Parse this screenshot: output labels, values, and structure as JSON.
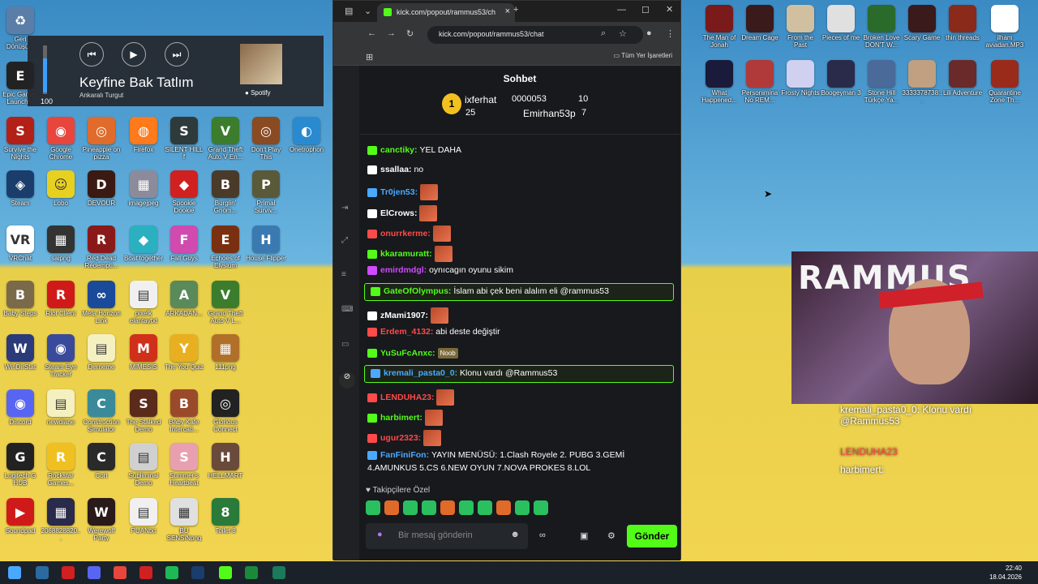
{
  "desktop_icons": [
    {
      "label": "Geri Dönüşüm",
      "color": "#5b7ea8",
      "glyph": "♻"
    },
    {
      "label": "Epic Games Launcher",
      "color": "#222222",
      "glyph": "E"
    },
    {
      "label": "Google Chrome",
      "color": "#e8453c",
      "glyph": "◉"
    },
    {
      "label": "Pineapple on pizza",
      "color": "#e06b2a",
      "glyph": "◎"
    },
    {
      "label": "Firefox",
      "color": "#ff7a1a",
      "glyph": "◍"
    },
    {
      "label": "SILENT HILL f",
      "color": "#2f3a3a",
      "glyph": "S"
    },
    {
      "label": "Grand Theft Auto V En...",
      "color": "#3b7d2c",
      "glyph": "V"
    },
    {
      "label": "Don't Play This",
      "color": "#8a4a22",
      "glyph": "◎"
    },
    {
      "label": "Onetrophon",
      "color": "#2a8ad0",
      "glyph": "◐"
    },
    {
      "label": "Survive the Nights",
      "color": "#b32018",
      "glyph": "S"
    },
    {
      "label": "Steam",
      "color": "#1b3d6b",
      "glyph": "◈"
    },
    {
      "label": "Lobo",
      "color": "#e8d020",
      "glyph": "☺"
    },
    {
      "label": "DEVOUR",
      "color": "#3a1a12",
      "glyph": "D"
    },
    {
      "label": "imagejpeg",
      "color": "#8b8b9b",
      "glyph": "▦"
    },
    {
      "label": "Spookie Dookie",
      "color": "#d02020",
      "glyph": "◆"
    },
    {
      "label": "Burglin' Gnom...",
      "color": "#4a3a2a",
      "glyph": "B"
    },
    {
      "label": "Primal Surviv...",
      "color": "#5a5a3a",
      "glyph": "P"
    },
    {
      "label": "VRChat",
      "color": "#ffffff",
      "glyph": "VR"
    },
    {
      "label": "saipng",
      "color": "#333333",
      "glyph": "▦"
    },
    {
      "label": "Red Dead Redempti...",
      "color": "#8a1a1a",
      "glyph": "R"
    },
    {
      "label": "Boat together",
      "color": "#2ab0c0",
      "glyph": "◆"
    },
    {
      "label": "Fall Guys",
      "color": "#d04ab0",
      "glyph": "F"
    },
    {
      "label": "Echoes of Elysium",
      "color": "#7a3010",
      "glyph": "E"
    },
    {
      "label": "House Flipper",
      "color": "#3a7ab0",
      "glyph": "H"
    },
    {
      "label": "Baby Steps",
      "color": "#7a6a4a",
      "glyph": "B"
    },
    {
      "label": "Riot Client",
      "color": "#d01a1a",
      "glyph": "R"
    },
    {
      "label": "Meta Horizon Link",
      "color": "#1a4a9a",
      "glyph": "∞"
    },
    {
      "label": "pixelk elantaytxt",
      "color": "#f0f0f0",
      "glyph": "▤"
    },
    {
      "label": "ARKADAN...",
      "color": "#5a8a5a",
      "glyph": "A"
    },
    {
      "label": "Grand Theft Auto V L...",
      "color": "#3b7d2c",
      "glyph": "V"
    },
    {
      "label": "WinDirStat",
      "color": "#2a3a7a",
      "glyph": "W"
    },
    {
      "label": "Steam Eye Tracker",
      "color": "#3a4a9a",
      "glyph": "◉"
    },
    {
      "label": "Derneme",
      "color": "#f4f0c0",
      "glyph": "▤"
    },
    {
      "label": "MIMESIS",
      "color": "#d0301a",
      "glyph": "M"
    },
    {
      "label": "The You Quiz",
      "color": "#e8b020",
      "glyph": "Y"
    },
    {
      "label": "111png",
      "color": "#b0702a",
      "glyph": "▦"
    },
    {
      "label": "Discord",
      "color": "#5865f2",
      "glyph": "◉"
    },
    {
      "label": "newdiane",
      "color": "#f4f0c0",
      "glyph": "▤"
    },
    {
      "label": "Construction Simulator",
      "color": "#3a8a9a",
      "glyph": "C"
    },
    {
      "label": "The Stalked Demo",
      "color": "#5a2a1a",
      "glyph": "S"
    },
    {
      "label": "Baby Kafe Intercati...",
      "color": "#9a4a2a",
      "glyph": "B"
    },
    {
      "label": "Glorious Connect",
      "color": "#222222",
      "glyph": "◎"
    },
    {
      "label": "Logitech G HUB",
      "color": "#222222",
      "glyph": "G"
    },
    {
      "label": "Rockstar Games...",
      "color": "#f0c020",
      "glyph": "R"
    },
    {
      "label": "Cort",
      "color": "#2a2a2a",
      "glyph": "C"
    },
    {
      "label": "Subliminal Demo",
      "color": "#d0d0d0",
      "glyph": "▤"
    },
    {
      "label": "Summer's Heartbeat",
      "color": "#e8a0b0",
      "glyph": "S"
    },
    {
      "label": "HELLMART",
      "color": "#6a4a3a",
      "glyph": "H"
    },
    {
      "label": "Soundpad",
      "color": "#d01a1a",
      "glyph": "▶"
    },
    {
      "label": "2068828820...",
      "color": "#2a2a4a",
      "glyph": "▦"
    },
    {
      "label": "Werewolf Party",
      "color": "#2a1a1a",
      "glyph": "W"
    },
    {
      "label": "PUANtxt",
      "color": "#f0f0f0",
      "glyph": "▤"
    },
    {
      "label": "BU SENSiNpng",
      "color": "#e0e0e0",
      "glyph": "▦"
    },
    {
      "label": "Toilet 8",
      "color": "#2a7a3a",
      "glyph": "8"
    }
  ],
  "media": {
    "volume": "100",
    "volume_level": 0.7,
    "title": "Keyfine Bak Tatlım",
    "artist": "Ankaralı Turgut",
    "source": "Spotify"
  },
  "browser": {
    "tab_title": "kick.com/popout/rammus53/ch",
    "url": "kick.com/popout/rammus53/chat",
    "bookmarks_label": "Tüm Yer İşaretleri"
  },
  "chat": {
    "title": "Sohbet",
    "leader1": {
      "rank": "1",
      "name": "ixferhat",
      "count": "25"
    },
    "leader2": {
      "value": "0000053",
      "count": "10"
    },
    "leader3": {
      "name": "Emirhan53p",
      "count": "7"
    },
    "messages": [
      {
        "user": "canctiky:",
        "text": "YEL DAHA",
        "color": "#53fc18"
      },
      {
        "user": "ssallaa:",
        "text": "no",
        "color": "#ffffff"
      },
      {
        "user": "Tr0jen53:",
        "text": "",
        "color": "#4aa8ff"
      },
      {
        "user": "ElCrows:",
        "text": "",
        "color": "#ffffff"
      },
      {
        "user": "onurrkerme:",
        "text": "",
        "color": "#ff4a4a"
      },
      {
        "user": "kkaramuratt:",
        "text": "",
        "color": "#53fc18"
      },
      {
        "user": "emirdmdgl:",
        "text": "oynıcagın oyunu sikim",
        "color": "#d04aff"
      },
      {
        "user": "GateOfOlympus:",
        "text": "İslam abi çek beni alalım eli @rammus53",
        "color": "#53fc18"
      },
      {
        "user": "zMami1907:",
        "text": "",
        "color": "#ffffff"
      },
      {
        "user": "Erdem_4132:",
        "text": "abi deste değiştir",
        "color": "#ff4a4a"
      },
      {
        "user": "YuSuFcAnxc:",
        "text": "",
        "color": "#53fc18"
      },
      {
        "user": "kremali_pasta0_0:",
        "text": "Klonu vardı @Rammus53",
        "color": "#4aa8ff"
      },
      {
        "user": "LENDUHA23:",
        "text": "",
        "color": "#ff4a4a"
      },
      {
        "user": "harbimert:",
        "text": "",
        "color": "#53fc18"
      },
      {
        "user": "ugur2323:",
        "text": "",
        "color": "#ff4a4a"
      },
      {
        "user": "FanFiniFon:",
        "text": "YAYIN MENÜSÜ: 1.Clash Royele 2. PUBG 3.GEMİ",
        "text2": "4.AMUNKUS 5.CS 6.NEW OYUN 7.NOVA PROKES 8.LOL",
        "color": "#4aa8ff"
      }
    ],
    "emote_label": "Noob",
    "followers_label": "Takipçilere Özel",
    "input_placeholder": "Bir mesaj gönderin",
    "send_label": "Gönder"
  },
  "right_icons": [
    {
      "label": "The Man of Jonah",
      "color": "#7a1a1a"
    },
    {
      "label": "Dream Cage",
      "color": "#3a1a1a"
    },
    {
      "label": "From the Past",
      "color": "#d0c0a0"
    },
    {
      "label": "Pieces of me",
      "color": "#e0e0e0"
    },
    {
      "label": "Broken Love DON'T W...",
      "color": "#2a6a2a"
    },
    {
      "label": "Scary Game",
      "color": "#3a1a1a"
    },
    {
      "label": "thin threads",
      "color": "#8a2a1a"
    },
    {
      "label": "ilham aviadan.MP3",
      "color": "#ffffff"
    },
    {
      "label": "What Happened...",
      "color": "#1a1a3a"
    },
    {
      "label": "Personimina No REM...",
      "color": "#b03a3a"
    },
    {
      "label": "Frosty Nights",
      "color": "#d0d0f0"
    },
    {
      "label": "Boogeyman 3",
      "color": "#2a2a4a"
    },
    {
      "label": "Stone Hill Türkçe Ya...",
      "color": "#4a6a9a"
    },
    {
      "label": "3333378738...",
      "color": "#c0a080"
    },
    {
      "label": "Lili Adventure",
      "color": "#6a2a2a"
    },
    {
      "label": "Quarantine Zone Th...",
      "color": "#9a2a1a"
    }
  ],
  "overlay": {
    "line1": "kremali_pasta0_0: Klonu vardı",
    "line2": "@Rammus53",
    "line3": "LENDUHA23",
    "line4": "harbimert:"
  },
  "webcam": {
    "brand": "RAMMUS"
  },
  "clock": {
    "time": "22:40",
    "date": "18.04.2026"
  }
}
